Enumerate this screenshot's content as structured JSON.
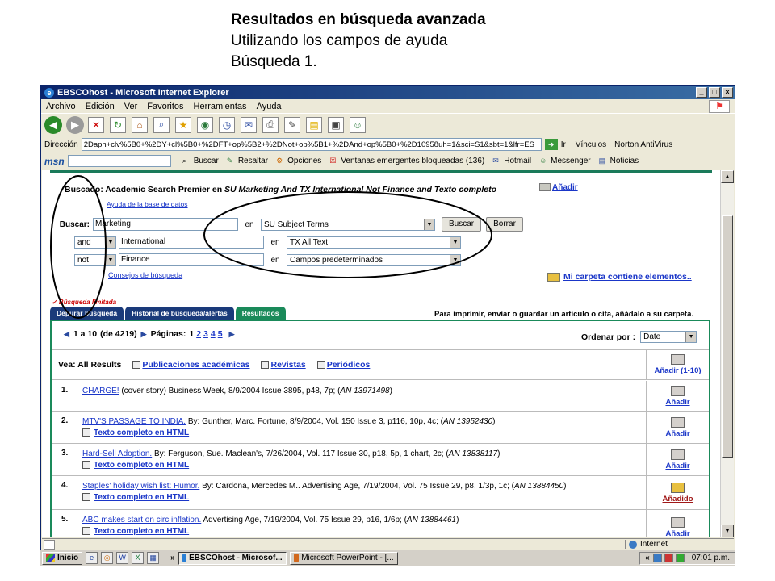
{
  "caption": {
    "line1": "Resultados en búsqueda avanzada",
    "line2": "Utilizando los campos de ayuda",
    "line3": "Búsqueda 1."
  },
  "window": {
    "title": "EBSCOhost - Microsoft Internet Explorer",
    "menu": [
      "Archivo",
      "Edición",
      "Ver",
      "Favoritos",
      "Herramientas",
      "Ayuda"
    ]
  },
  "address": {
    "label": "Dirección",
    "url": "2Daph+clv%5B0+%2DY+cl%5B0+%2DFT+op%5B2+%2DNot+op%5B1+%2DAnd+op%5B0+%2D10958uh=1&sci=S1&sbt=1&lfr=ES",
    "go_label": "Ir",
    "links_label": "Vínculos",
    "norton_label": "Norton AntiVirus"
  },
  "links_bar": {
    "buscar": "Buscar",
    "resaltar": "Resaltar",
    "opciones": "Opciones",
    "ventanas": "Ventanas emergentes bloqueadas (136)",
    "hotmail": "Hotmail",
    "messenger": "Messenger",
    "noticias": "Noticias"
  },
  "search": {
    "prefix": "Buscado: Academic Search Premier en",
    "query": "SU Marketing And TX International Not Finance and Texto completo",
    "add_label": "Añadir",
    "help_db": "Ayuda de la base de datos",
    "buscar_label": "Buscar:",
    "rows": [
      {
        "op": "",
        "term": "Marketing",
        "en": "en",
        "field": "SU Subject Terms"
      },
      {
        "op": "and",
        "term": "International",
        "en": "en",
        "field": "TX All Text"
      },
      {
        "op": "not",
        "term": "Finance",
        "en": "en",
        "field": "Campos predeterminados"
      }
    ],
    "btn_search": "Buscar",
    "btn_clear": "Borrar",
    "tips": "Consejos de búsqueda",
    "folder_link": "Mi carpeta contiene elementos..",
    "limited": "✓ Búsqueda limitada"
  },
  "tabs": [
    "Depurar búsqueda",
    "Historial de búsqueda/alertas",
    "Resultados"
  ],
  "print_hint": "Para imprimir, enviar o guardar un artículo o cita, añádalo a su carpeta.",
  "results": {
    "range": "1 a 10",
    "total": "(de 4219)",
    "pages_label": "Páginas:",
    "pages": [
      "1",
      "2",
      "3",
      "4",
      "5"
    ],
    "sort_label": "Ordenar por :",
    "sort_value": "Date",
    "vea_label": "Vea: All Results",
    "filters": [
      "Publicaciones académicas",
      "Revistas",
      "Periódicos"
    ],
    "add_range": "Añadir (1-10)",
    "fulltext_label": "Texto completo en HTML",
    "items": [
      {
        "num": "1.",
        "title": "CHARGE!",
        "rest": " (cover story) Business Week, 8/9/2004 Issue 3895, p48, 7p; (",
        "an": "AN 13971498",
        "close": ")",
        "fulltext": false,
        "action": "Añadir"
      },
      {
        "num": "2.",
        "title": "MTV'S PASSAGE TO INDIA.",
        "rest": " By: Gunther, Marc. Fortune, 8/9/2004, Vol. 150 Issue 3, p116, 10p, 4c; (",
        "an": "AN 13952430",
        "close": ")",
        "fulltext": true,
        "action": "Añadir"
      },
      {
        "num": "3.",
        "title": "Hard-Sell Adoption.",
        "rest": " By: Ferguson, Sue. Maclean's, 7/26/2004, Vol. 117 Issue 30, p18, 5p, 1 chart, 2c; (",
        "an": "AN 13838117",
        "close": ")",
        "fulltext": true,
        "action": "Añadir"
      },
      {
        "num": "4.",
        "title": "Staples' holiday wish list: Humor.",
        "rest": " By: Cardona, Mercedes M.. Advertising Age, 7/19/2004, Vol. 75 Issue 29, p8, 1/3p, 1c; (",
        "an": "AN 13884450",
        "close": ")",
        "fulltext": true,
        "action": "Añadido"
      },
      {
        "num": "5.",
        "title": "ABC makes start on circ inflation.",
        "rest": " Advertising Age, 7/19/2004, Vol. 75 Issue 29, p16, 1/6p; (",
        "an": "AN 13884461",
        "close": ")",
        "fulltext": true,
        "action": "Añadir"
      }
    ]
  },
  "status": {
    "zone": "Internet"
  },
  "taskbar": {
    "start": "Inicio",
    "tasks": [
      "EBSCOhost - Microsof...",
      "Microsoft PowerPoint - [..."
    ],
    "clock": "07:01 p.m."
  }
}
